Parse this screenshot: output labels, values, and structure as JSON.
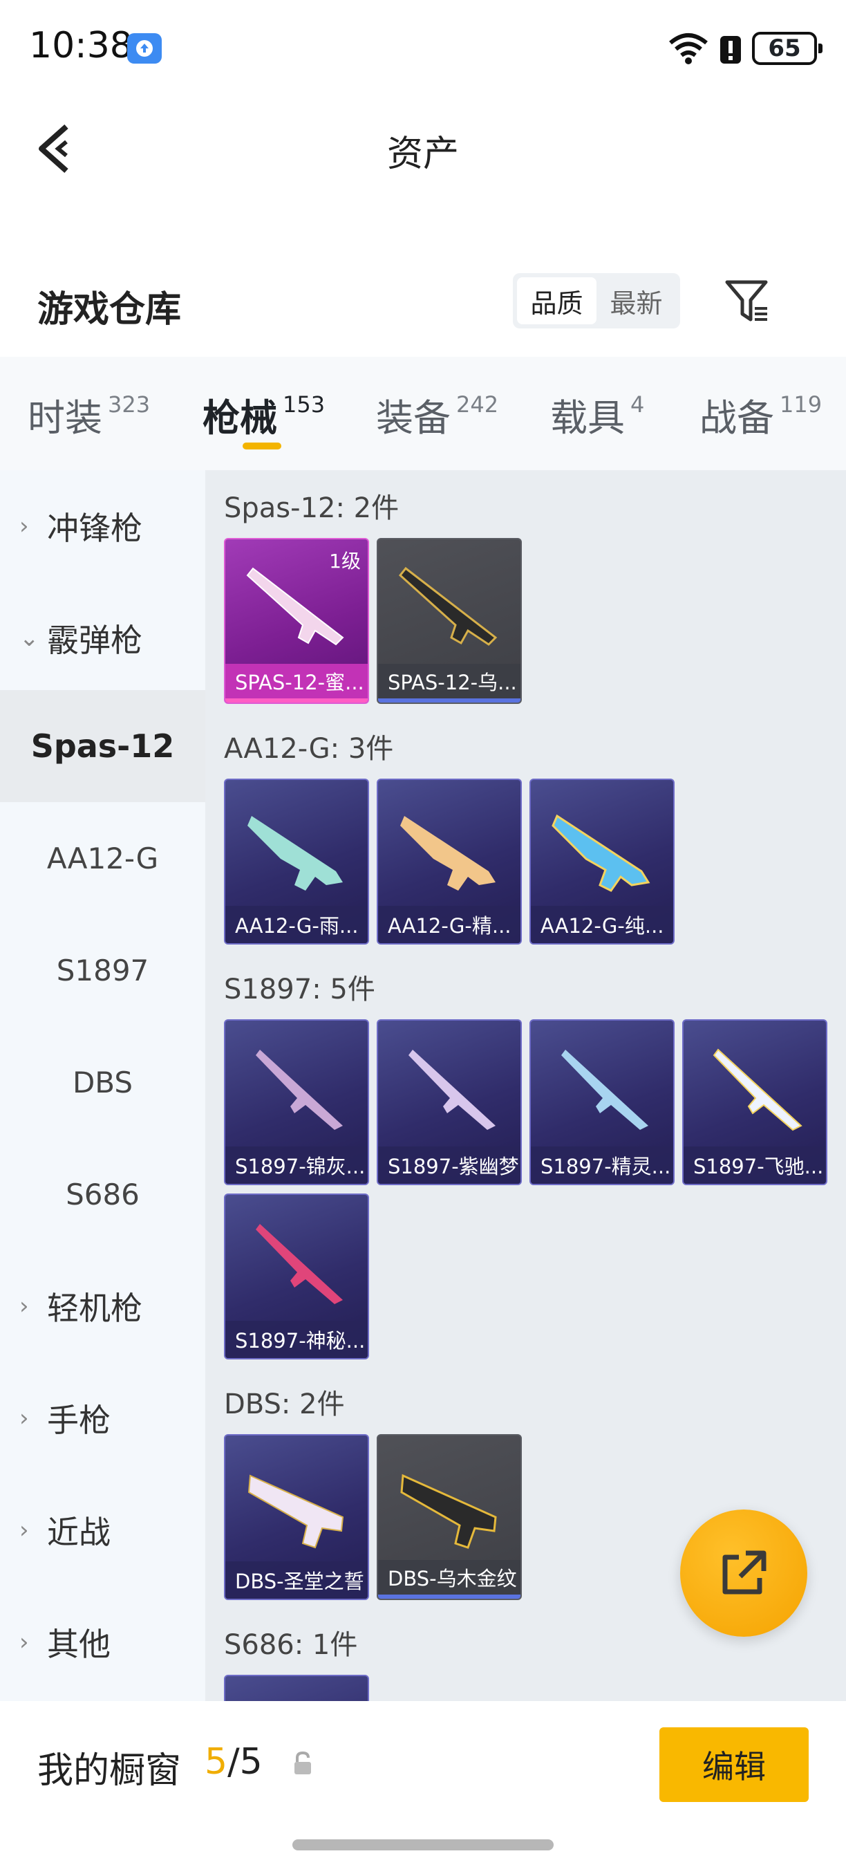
{
  "status_bar": {
    "time": "10:38",
    "battery": "65"
  },
  "header": {
    "title": "资产"
  },
  "section": {
    "title": "游戏仓库",
    "sort_options": [
      "品质",
      "最新"
    ],
    "sort_active": "品质"
  },
  "categories": [
    {
      "label": "时装",
      "count": "323"
    },
    {
      "label": "枪械",
      "count": "153",
      "active": true
    },
    {
      "label": "装备",
      "count": "242"
    },
    {
      "label": "载具",
      "count": "4"
    },
    {
      "label": "战备",
      "count": "119"
    }
  ],
  "sidebar": {
    "groups": [
      {
        "label": "冲锋枪",
        "expanded": false
      },
      {
        "label": "霰弹枪",
        "expanded": true
      },
      {
        "label": "轻机枪",
        "expanded": false
      },
      {
        "label": "手枪",
        "expanded": false
      },
      {
        "label": "近战",
        "expanded": false
      },
      {
        "label": "其他",
        "expanded": false
      }
    ],
    "subitems": [
      "Spas-12",
      "AA12-G",
      "S1897",
      "DBS",
      "S686"
    ],
    "active_subitem": "Spas-12"
  },
  "groups": [
    {
      "title": "Spas-12: 2件",
      "items": [
        "SPAS-12-蜜...",
        "SPAS-12-乌..."
      ],
      "level_badge": "1级"
    },
    {
      "title": "AA12-G: 3件",
      "items": [
        "AA12-G-雨...",
        "AA12-G-精...",
        "AA12-G-纯..."
      ]
    },
    {
      "title": "S1897: 5件",
      "items": [
        "S1897-锦灰...",
        "S1897-紫幽梦",
        "S1897-精灵...",
        "S1897-飞驰...",
        "S1897-神秘..."
      ]
    },
    {
      "title": "DBS: 2件",
      "items": [
        "DBS-圣堂之誓",
        "DBS-乌木金纹"
      ]
    },
    {
      "title": "S686: 1件",
      "items": []
    }
  ],
  "showcase": {
    "label": "我的橱窗",
    "current": "5",
    "separator": "/",
    "total": "5",
    "edit_label": "编辑"
  },
  "colors": {
    "accent": "#f9b800",
    "purple_card": "#302c6a",
    "pink_card": "#a13bb7"
  }
}
